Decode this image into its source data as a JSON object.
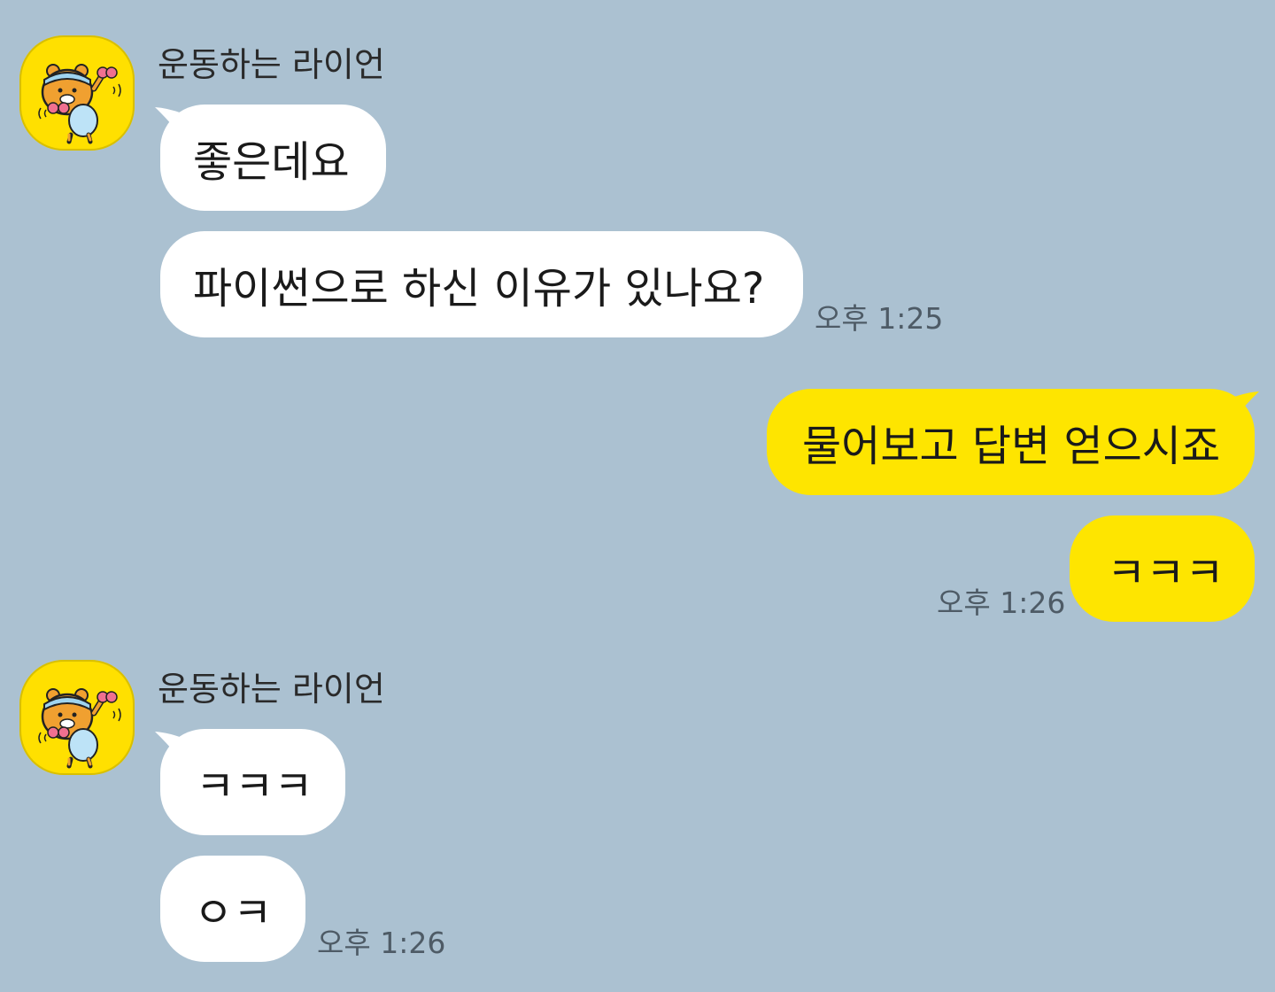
{
  "chat": {
    "groups": [
      {
        "sender": "운동하는 라이언",
        "avatar_icon": "ryan-character-avatar",
        "messages": [
          "좋은데요",
          "파이썬으로 하신 이유가 있나요?"
        ],
        "time": "오후 1:25"
      },
      {
        "sender": "me",
        "messages": [
          "물어보고 답변 얻으시죠",
          "ㅋㅋㅋ"
        ],
        "time": "오후 1:26"
      },
      {
        "sender": "운동하는 라이언",
        "avatar_icon": "ryan-character-avatar",
        "messages": [
          "ㅋㅋㅋ",
          "ㅇㅋ"
        ],
        "time": "오후 1:26"
      }
    ]
  },
  "colors": {
    "background": "#abc1d1",
    "incoming_bubble": "#ffffff",
    "outgoing_bubble": "#fee500",
    "avatar_bg": "#ffe000"
  }
}
